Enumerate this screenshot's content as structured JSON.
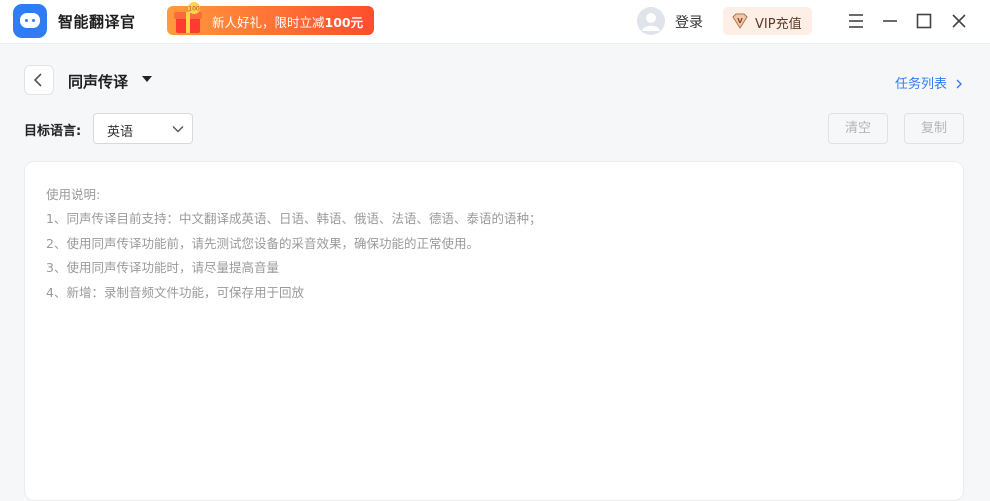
{
  "app": {
    "title": "智能翻译官"
  },
  "promo": {
    "text_prefix": "新人好礼，限时立减",
    "amount": "100元"
  },
  "account": {
    "login_label": "登录",
    "vip_label": "VIP充值"
  },
  "window_controls": [
    "menu-icon",
    "minimize-icon",
    "maximize-icon",
    "close-icon"
  ],
  "page": {
    "title": "同声传译",
    "task_list_label": "任务列表",
    "target_lang_label": "目标语言:",
    "target_lang_value": "英语",
    "clear_label": "清空",
    "copy_label": "复制"
  },
  "instructions": {
    "heading": "使用说明:",
    "items": [
      "1、同声传译目前支持：中文翻译成英语、日语、韩语、俄语、法语、德语、泰语的语种；",
      "2、使用同声传译功能前，请先测试您设备的采音效果，确保功能的正常使用。",
      "3、使用同声传译功能时，请尽量提高音量",
      "4、新增：录制音频文件功能，可保存用于回放"
    ]
  },
  "colors": {
    "accent": "#2f7cf6",
    "promo_start": "#ff9a3d",
    "promo_end": "#ff4d2e",
    "vip_bg": "#fdeee6",
    "disabled_text": "#b5b5b5"
  }
}
